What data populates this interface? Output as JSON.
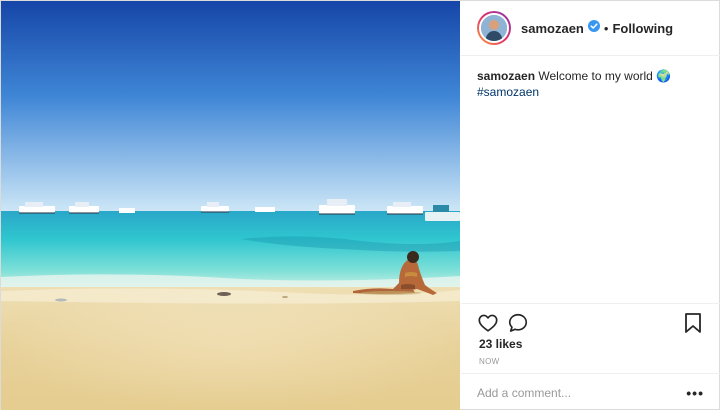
{
  "post": {
    "username": "samozaen",
    "verified": true,
    "follow_separator": "•",
    "follow_status": "Following",
    "caption": {
      "username": "samozaen",
      "text": "Welcome to my world 🌍",
      "hashtag": "#samozaen"
    },
    "likes": "23 likes",
    "timestamp": "NOW",
    "comment_placeholder": "Add a comment...",
    "more_label": "•••"
  },
  "photo": {
    "subject": "beach-scene",
    "colors": {
      "sky_top": "#1a4fb0",
      "sky_bottom": "#c3e2f5",
      "sea": "#2ec5d0",
      "sand": "#efd9a0"
    }
  },
  "icons": {
    "like": "heart-icon",
    "comment": "comment-icon",
    "save": "bookmark-icon",
    "verified": "verified-badge-icon"
  },
  "colors": {
    "verified_blue": "#3897f0",
    "hashtag": "#003569",
    "text": "#262626",
    "muted": "#999999",
    "divider": "#efefef"
  }
}
